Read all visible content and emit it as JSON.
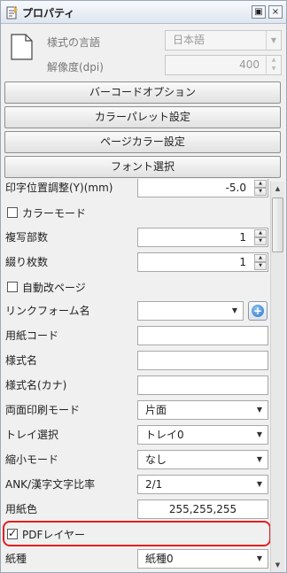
{
  "window": {
    "title": "プロパティ",
    "pin_glyph": "▣",
    "close_glyph": "×"
  },
  "header": {
    "language_label": "様式の言語",
    "language_value": "日本語",
    "dpi_label": "解像度(dpi)",
    "dpi_value": "400"
  },
  "buttons": [
    {
      "label": "バーコードオプション"
    },
    {
      "label": "カラーパレット設定"
    },
    {
      "label": "ページカラー設定"
    },
    {
      "label": "フォント選択"
    }
  ],
  "properties": {
    "print_pos_y": {
      "label": "印字位置調整(Y)(mm)",
      "value": "-5.0"
    },
    "color_mode": {
      "label": "カラーモード",
      "checked": false
    },
    "copies": {
      "label": "複写部数",
      "value": "1"
    },
    "bind_count": {
      "label": "綴り枚数",
      "value": "1"
    },
    "auto_page": {
      "label": "自動改ページ",
      "checked": false
    },
    "link_form": {
      "label": "リンクフォーム名",
      "value": ""
    },
    "paper_code": {
      "label": "用紙コード",
      "value": ""
    },
    "form_name": {
      "label": "様式名",
      "value": ""
    },
    "form_name_kana": {
      "label": "様式名(カナ)",
      "value": ""
    },
    "duplex": {
      "label": "両面印刷モード",
      "value": "片面"
    },
    "tray": {
      "label": "トレイ選択",
      "value": "トレイ0"
    },
    "shrink": {
      "label": "縮小モード",
      "value": "なし"
    },
    "ank_ratio": {
      "label": "ANK/漢字文字比率",
      "value": "2/1"
    },
    "paper_color": {
      "label": "用紙色",
      "value": "255,255,255"
    },
    "pdf_layer": {
      "label": "PDFレイヤー",
      "checked": true
    },
    "paper_type": {
      "label": "紙種",
      "value": "紙種0"
    }
  },
  "colors": {
    "highlight": "#e02020",
    "titlebar": "#dfe6ef"
  }
}
